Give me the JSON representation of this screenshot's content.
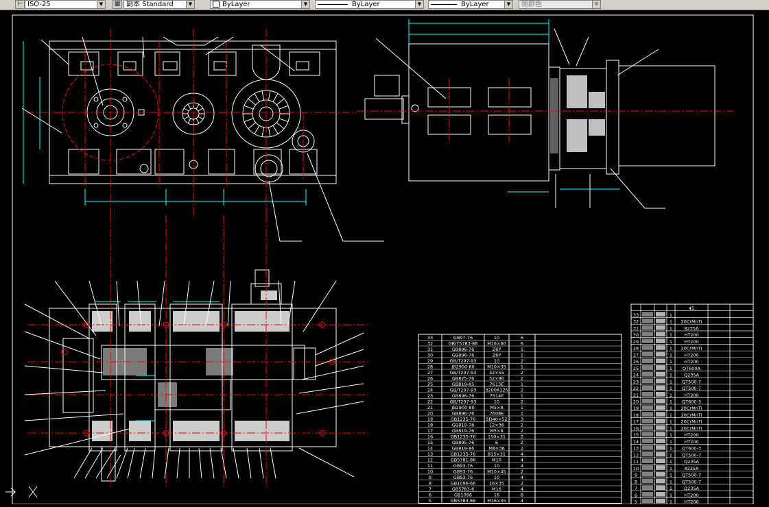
{
  "toolbar": {
    "dimstyle_value": "ISO-25",
    "copy_label": "副本 Standard",
    "layer_value": "ByLayer",
    "linetype_value": "ByLayer",
    "lineweight_value": "ByLayer",
    "color_value": "随颜色"
  },
  "drawing": {
    "bom_left": [
      [
        "33",
        "GB97-76",
        "10",
        "6"
      ],
      [
        "32",
        "GB/T5783-86",
        "M16×60",
        "6"
      ],
      [
        "31",
        "GB896-76",
        "Z6P",
        "1"
      ],
      [
        "30",
        "GB896-76",
        "Z6P",
        "1"
      ],
      [
        "29",
        "GB/T297-93",
        "10",
        "2"
      ],
      [
        "28",
        "JB2900-80",
        "M10×35",
        "1"
      ],
      [
        "27",
        "GB/T297-93",
        "32×55",
        "2"
      ],
      [
        "26",
        "GB825-76",
        "32×90",
        "2"
      ],
      [
        "25",
        "GB819-85",
        "7613E",
        "1"
      ],
      [
        "24",
        "GB/T297-93",
        "3200A125",
        "2"
      ],
      [
        "23",
        "GB896-76",
        "7514E",
        "1"
      ],
      [
        "22",
        "GB/T297-93",
        "10",
        "2"
      ],
      [
        "21",
        "JB2900-80",
        "M5×8",
        "1"
      ],
      [
        "20",
        "GB896-76",
        "7608E",
        "1"
      ],
      [
        "19",
        "GB1235-76",
        "SD40×52",
        "3"
      ],
      [
        "18",
        "GB819-76",
        "12×36",
        "2"
      ],
      [
        "17",
        "GB819-76",
        "M5×8",
        "2"
      ],
      [
        "16",
        "GB1235-76",
        "150×31",
        "2"
      ],
      [
        "15",
        "GB895-76",
        "6",
        "2"
      ],
      [
        "14",
        "GB819-86",
        "M8×36",
        "2"
      ],
      [
        "13",
        "GB1235-76",
        "815×31",
        "4"
      ],
      [
        "12",
        "GB5781-86",
        "M10",
        "4"
      ],
      [
        "11",
        "GB93-76",
        "10",
        "4"
      ],
      [
        "10",
        "GB93-76",
        "M10×45",
        "2"
      ],
      [
        "9",
        "GB93-76",
        "10",
        "4"
      ],
      [
        "8",
        "GB1096-66",
        "16×35",
        "2"
      ],
      [
        "7",
        "GB5783-6",
        "M16",
        "4"
      ],
      [
        "6",
        "GB1096",
        "16",
        "8"
      ],
      [
        "5",
        "GB5783-86",
        "M16×35",
        "4"
      ]
    ],
    "bom_right_header": "45",
    "bom_right": [
      [
        "33",
        "1",
        ""
      ],
      [
        "32",
        "1",
        "20CrMnTi"
      ],
      [
        "31",
        "1",
        "8235A"
      ],
      [
        "30",
        "1",
        "HT200"
      ],
      [
        "29",
        "1",
        "HT200"
      ],
      [
        "28",
        "1",
        "20CrMnTi"
      ],
      [
        "27",
        "1",
        "HT200"
      ],
      [
        "26",
        "1",
        "HT200"
      ],
      [
        "25",
        "1",
        "QT600A"
      ],
      [
        "24",
        "1",
        "Q235A"
      ],
      [
        "23",
        "1",
        "QT500-7"
      ],
      [
        "22",
        "1",
        "QT500-7"
      ],
      [
        "21",
        "1",
        "HT200"
      ],
      [
        "20",
        "1",
        "QT600-3"
      ],
      [
        "19",
        "1",
        "20CrMnTi"
      ],
      [
        "18",
        "1",
        "20CrMnTi"
      ],
      [
        "17",
        "1",
        "20CrMnTi"
      ],
      [
        "16",
        "1",
        "20CrMnTi"
      ],
      [
        "15",
        "1",
        "HT200"
      ],
      [
        "14",
        "1",
        "HT200"
      ],
      [
        "13",
        "1",
        "QT600-3"
      ],
      [
        "12",
        "1",
        "QT500-7"
      ],
      [
        "11",
        "1",
        "Q235A"
      ],
      [
        "10",
        "1",
        "8235A"
      ],
      [
        "9",
        "1",
        "QT500-7"
      ],
      [
        "8",
        "1",
        "QT500-7"
      ],
      [
        "7",
        "1",
        "Q235A"
      ],
      [
        "6",
        "1",
        "HT200"
      ],
      [
        "5",
        "1",
        "HT200"
      ]
    ]
  },
  "colors": {
    "background": "#000000",
    "geometry": "#ffffff",
    "centerline": "#ff0000",
    "dimension": "#00ffff",
    "hatch": "#ffffff"
  }
}
